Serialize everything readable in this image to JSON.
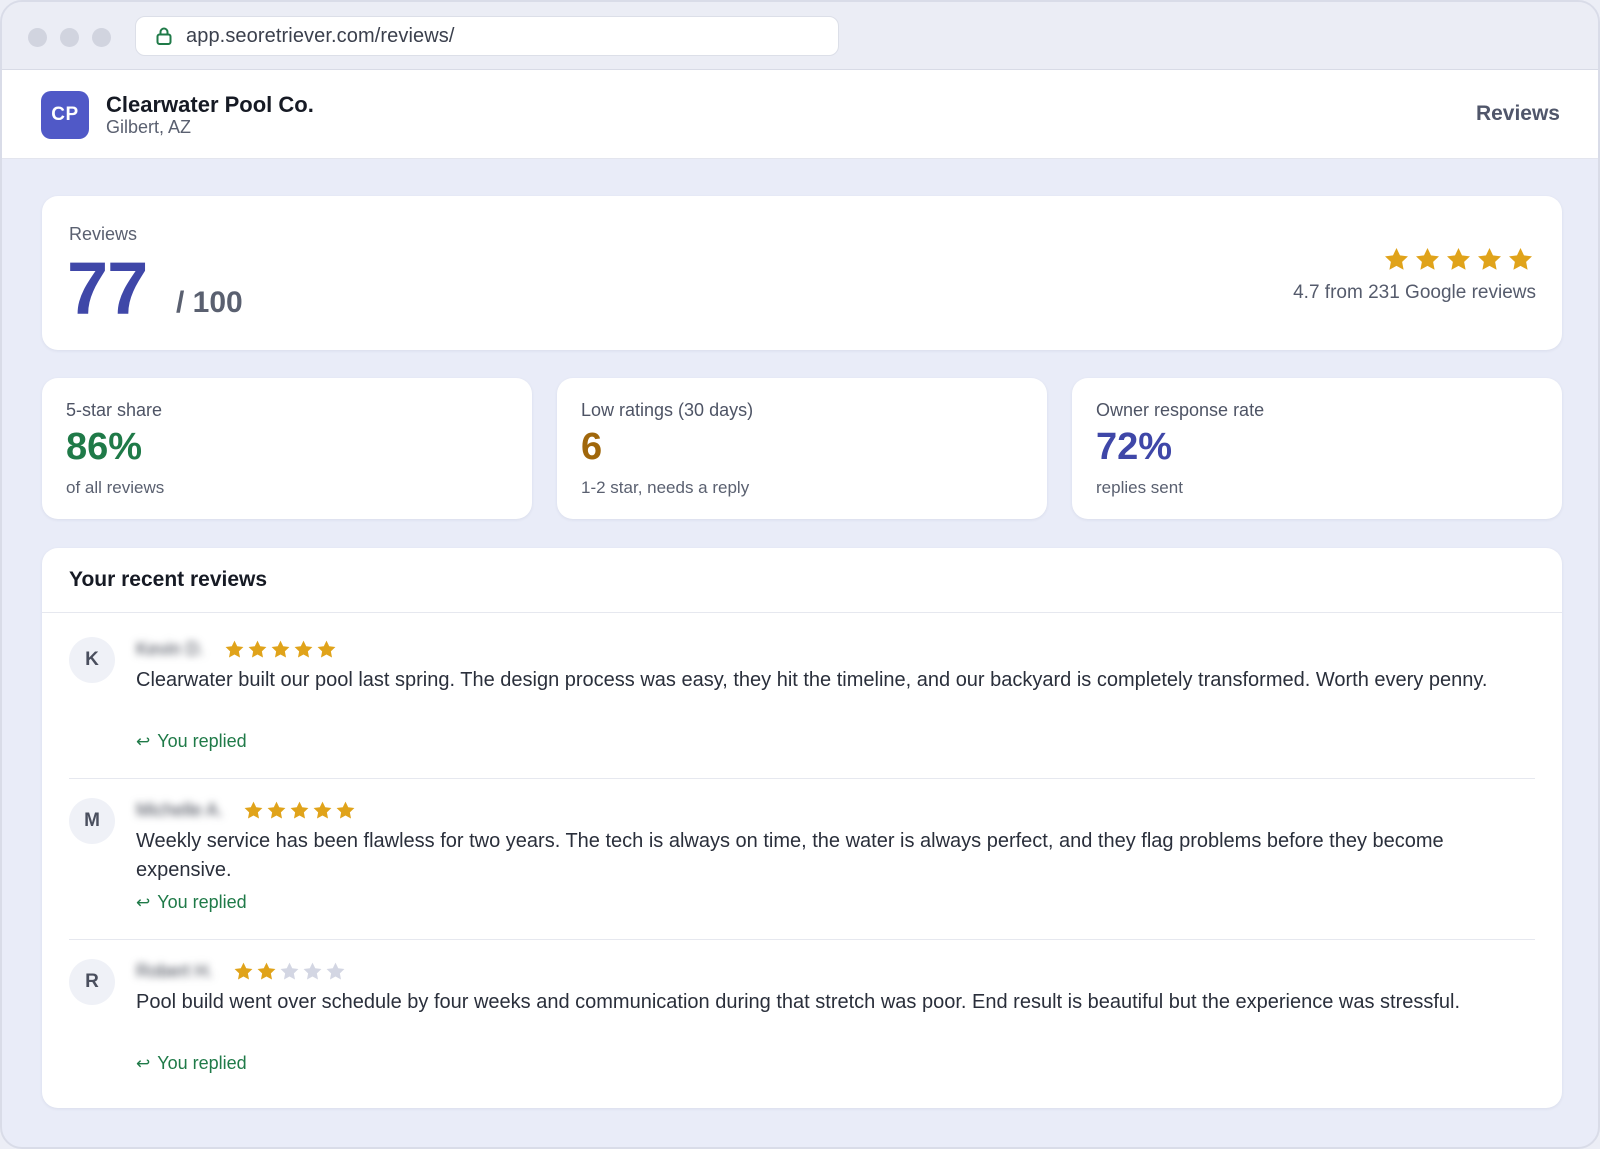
{
  "browser": {
    "url": "app.seoretriever.com/reviews/"
  },
  "header": {
    "logo_initials": "CP",
    "business_name": "Clearwater Pool Co.",
    "location": "Gilbert, AZ",
    "nav_reviews": "Reviews"
  },
  "score": {
    "label": "Reviews",
    "value": "77",
    "max": "/ 100",
    "rating": 4.7,
    "rating_text": "4.7 from 231 Google reviews"
  },
  "metrics": [
    {
      "label": "5-star share",
      "value": "86%",
      "sub": "of all reviews",
      "color": "#1f7a48"
    },
    {
      "label": "Low ratings (30 days)",
      "value": "6",
      "sub": "1-2 star, needs a reply",
      "color": "#a0670b"
    },
    {
      "label": "Owner response rate",
      "value": "72%",
      "sub": "replies sent",
      "color": "#3f47a8"
    }
  ],
  "recent": {
    "title": "Your recent reviews",
    "reviews": [
      {
        "initial": "K",
        "name": "Kevin D.",
        "stars": 5,
        "text": "Clearwater built our pool last spring. The design process was easy, they hit the timeline, and our backyard is completely transformed. Worth every penny.",
        "reply_status": "You replied"
      },
      {
        "initial": "M",
        "name": "Michelle A.",
        "stars": 5,
        "text": "Weekly service has been flawless for two years. The tech is always on time, the water is always perfect, and they flag problems before they become expensive.",
        "reply_status": "You replied"
      },
      {
        "initial": "R",
        "name": "Robert H.",
        "stars": 2,
        "text": "Pool build went over schedule by four weeks and communication during that stretch was poor. End result is beautiful but the experience was stressful.",
        "reply_status": "You replied"
      }
    ]
  },
  "colors": {
    "accent": "#3f47a8",
    "logo": "#5059c7",
    "star_filled": "#e0a31a",
    "star_empty": "#d3d6e3",
    "success": "#1f7a48"
  },
  "icons": {
    "lock": "lock-icon",
    "reply": "reply-arrow-icon",
    "star": "star-icon"
  }
}
